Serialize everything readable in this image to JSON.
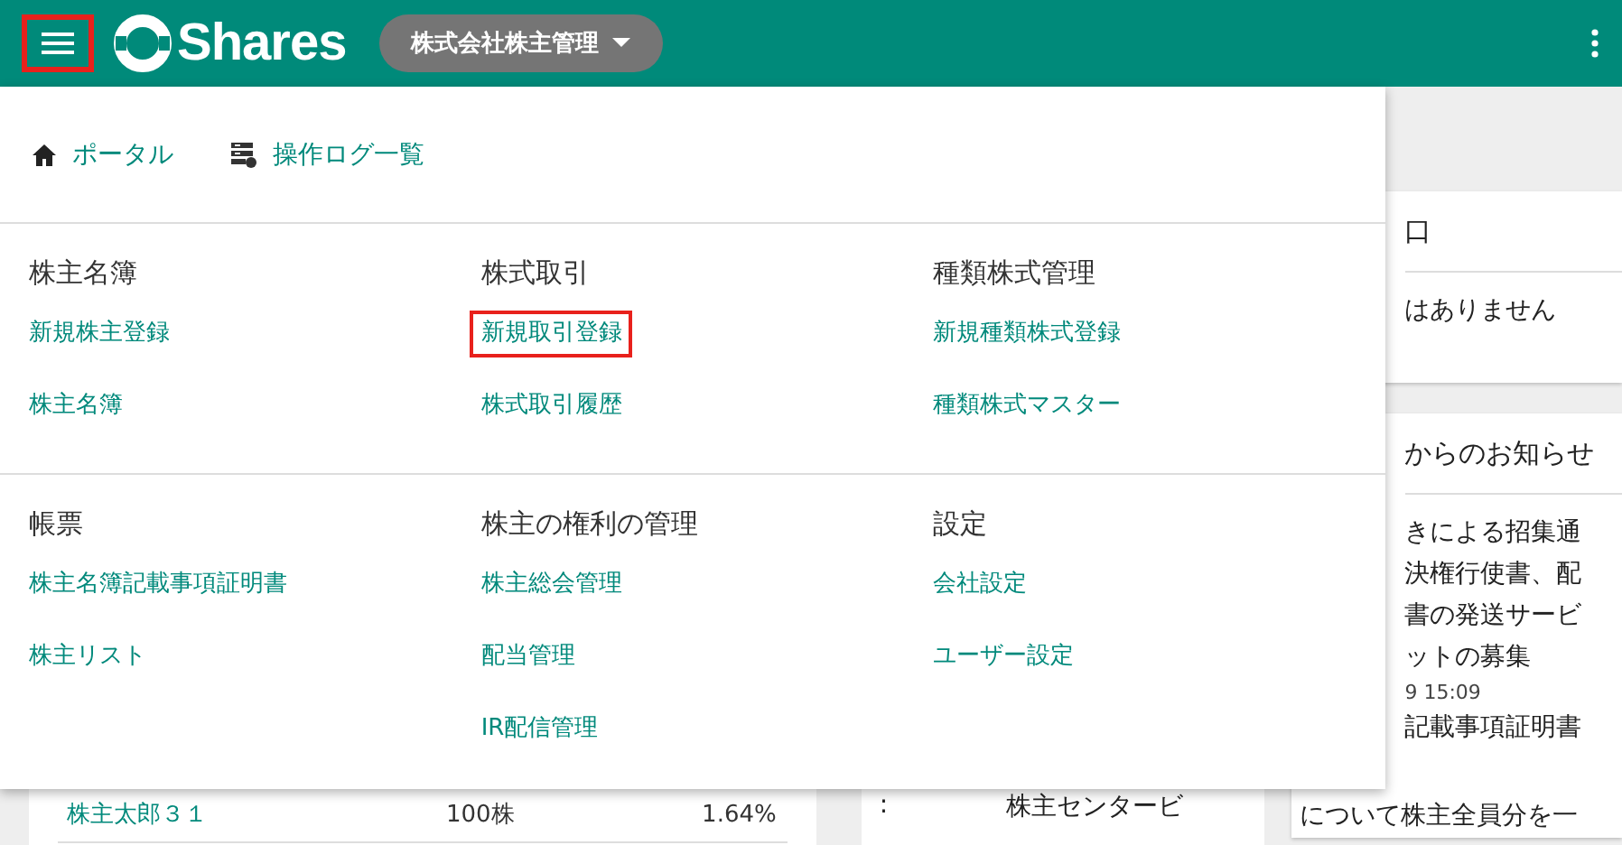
{
  "header": {
    "menu_button": {
      "highlighted": true
    },
    "logo": "Shares",
    "company_select": "株式会社株主管理"
  },
  "menu": {
    "quick_links": [
      {
        "kind": "home",
        "label": "ポータル"
      },
      {
        "kind": "log",
        "label": "操作ログ一覧"
      }
    ],
    "section_rows": [
      [
        {
          "title": "株主名簿",
          "links": [
            {
              "label": "新規株主登録",
              "highlighted": false
            },
            {
              "label": "株主名簿",
              "highlighted": false
            }
          ]
        },
        {
          "title": "株式取引",
          "links": [
            {
              "label": "新規取引登録",
              "highlighted": true
            },
            {
              "label": "株式取引履歴",
              "highlighted": false
            }
          ]
        },
        {
          "title": "種類株式管理",
          "links": [
            {
              "label": "新規種類株式登録",
              "highlighted": false
            },
            {
              "label": "種類株式マスター",
              "highlighted": false
            }
          ]
        }
      ],
      [
        {
          "title": "帳票",
          "links": [
            {
              "label": "株主名簿記載事項証明書",
              "highlighted": false
            },
            {
              "label": "株主リスト",
              "highlighted": false
            }
          ]
        },
        {
          "title": "株主の権利の管理",
          "links": [
            {
              "label": "株主総会管理",
              "highlighted": false
            },
            {
              "label": "配当管理",
              "highlighted": false
            },
            {
              "label": "IR配信管理",
              "highlighted": false
            }
          ]
        },
        {
          "title": "設定",
          "links": [
            {
              "label": "会社設定",
              "highlighted": false
            },
            {
              "label": "ユーザー設定",
              "highlighted": false
            }
          ]
        }
      ]
    ]
  },
  "shareholder_row": {
    "name": "株主太郎３１",
    "shares": "100株",
    "ratio": "1.64%"
  },
  "address_row": {
    "separator": ":",
    "value": "株主センタービ"
  },
  "right_cards": [
    {
      "header": "口",
      "body": [
        "はありません"
      ]
    },
    {
      "header": "からのお知らせ",
      "body": [
        "きによる招集通",
        "決権行使書、配",
        "書の発送サービ",
        "ットの募集"
      ],
      "date": "9 15:09",
      "more": [
        "記載事項証明書"
      ],
      "tail": "について株主全員分を一"
    }
  ]
}
